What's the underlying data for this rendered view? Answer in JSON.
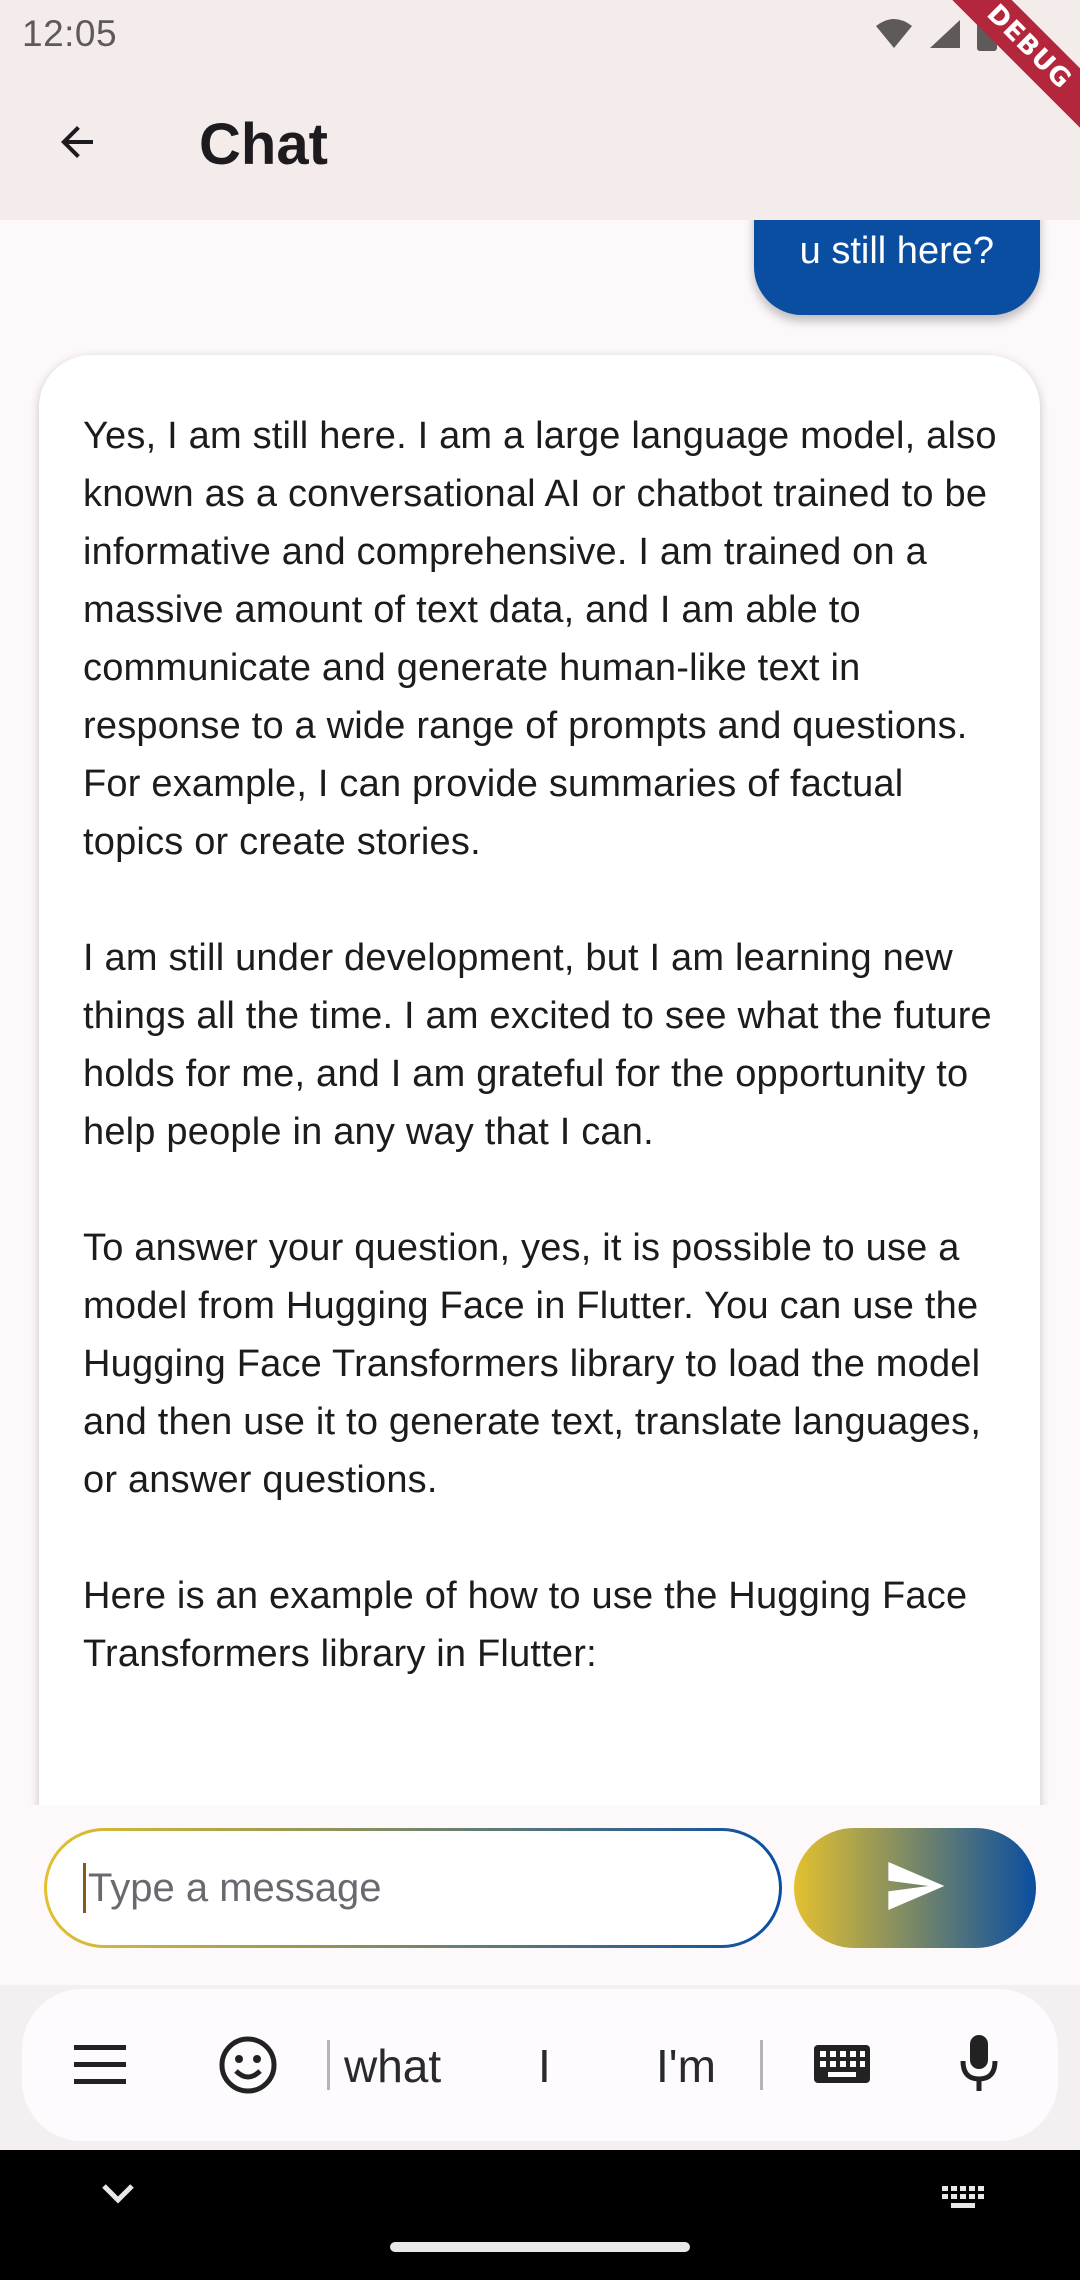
{
  "status_bar": {
    "time": "12:05",
    "debug_label": "DEBUG"
  },
  "app_bar": {
    "title": "Chat"
  },
  "messages": {
    "user": "u still here?",
    "bot": "Yes, I am still here. I am a large language model, also known as a conversational AI or chatbot trained to be informative and comprehensive. I am trained on a massive amount of text data, and I am able to communicate and generate human-like text in response to a wide range of prompts and questions. For example, I can provide summaries of factual topics or create stories.\n\nI am still under development, but I am learning new things all the time. I am excited to see what the future holds for me, and I am grateful for the opportunity to help people in any way that I can.\n\nTo answer your question, yes, it is possible to use a model from Hugging Face in Flutter. You can use the Hugging Face Transformers library to load the model and then use it to generate text, translate languages, or answer questions.\n\nHere is an example of how to use the Hugging Face Transformers library in Flutter:"
  },
  "composer": {
    "placeholder": "Type a message",
    "value": ""
  },
  "keyboard": {
    "suggestions": [
      "what",
      "I",
      "I'm"
    ]
  },
  "colors": {
    "accent_blue": "#0a4ea1",
    "accent_yellow": "#e3c02f",
    "app_bar_bg": "#f3ecea"
  }
}
